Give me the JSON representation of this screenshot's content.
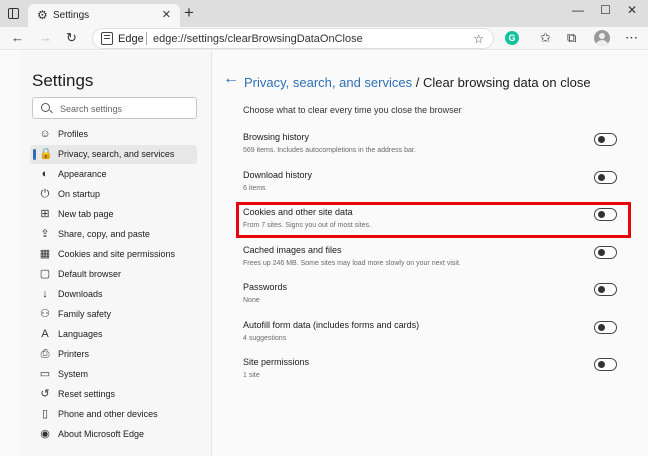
{
  "browser": {
    "tab_title": "Settings",
    "tab_icon": "⚙",
    "tab_close": "✕",
    "new_tab": "+",
    "window_controls": {
      "minimize": "—",
      "maximize": "☐",
      "close": "✕"
    },
    "nav": {
      "back": "←",
      "forward": "→",
      "refresh": "↻"
    },
    "address": {
      "site_label": "Edge",
      "url": "edge://settings/clearBrowsingDataOnClose",
      "favorite_icon": "☆"
    },
    "extensions": {
      "grammarly": "G"
    },
    "toolbar_icons": {
      "favorites": "✩",
      "collections": "⧉",
      "menu": "⋯"
    }
  },
  "sidebar": {
    "title": "Settings",
    "search_placeholder": "Search settings",
    "items": [
      {
        "label": "Profiles",
        "icon": "☺"
      },
      {
        "label": "Privacy, search, and services",
        "icon": "🔒",
        "active": true
      },
      {
        "label": "Appearance",
        "icon": "◐"
      },
      {
        "label": "On startup",
        "icon": "⏻"
      },
      {
        "label": "New tab page",
        "icon": "⊞"
      },
      {
        "label": "Share, copy, and paste",
        "icon": "⇪"
      },
      {
        "label": "Cookies and site permissions",
        "icon": "▦"
      },
      {
        "label": "Default browser",
        "icon": "▢"
      },
      {
        "label": "Downloads",
        "icon": "↓"
      },
      {
        "label": "Family safety",
        "icon": "⚇"
      },
      {
        "label": "Languages",
        "icon": "A"
      },
      {
        "label": "Printers",
        "icon": "⎙"
      },
      {
        "label": "System",
        "icon": "▭"
      },
      {
        "label": "Reset settings",
        "icon": "↺"
      },
      {
        "label": "Phone and other devices",
        "icon": "▯"
      },
      {
        "label": "About Microsoft Edge",
        "icon": "◉"
      }
    ]
  },
  "main": {
    "back_icon": "←",
    "breadcrumb": {
      "parent": "Privacy, search, and services",
      "separator": " / ",
      "current": "Clear browsing data on close"
    },
    "intro": "Choose what to clear every time you close the browser",
    "settings": [
      {
        "title": "Browsing history",
        "description": "569 items. Includes autocompletions in the address bar.",
        "enabled": false
      },
      {
        "title": "Download history",
        "description": "6 items",
        "enabled": false
      },
      {
        "title": "Cookies and other site data",
        "description": "From 7 sites. Signs you out of most sites.",
        "enabled": false,
        "highlighted": true
      },
      {
        "title": "Cached images and files",
        "description": "Frees up 246 MB. Some sites may load more slowly on your next visit.",
        "enabled": false
      },
      {
        "title": "Passwords",
        "description": "None",
        "enabled": false
      },
      {
        "title": "Autofill form data (includes forms and cards)",
        "description": "4 suggestions",
        "enabled": false
      },
      {
        "title": "Site permissions",
        "description": "1 site",
        "enabled": false
      }
    ]
  },
  "colors": {
    "accent": "#2e6fb6",
    "highlight": "#e4080a",
    "tabstrip": "#dedede"
  }
}
